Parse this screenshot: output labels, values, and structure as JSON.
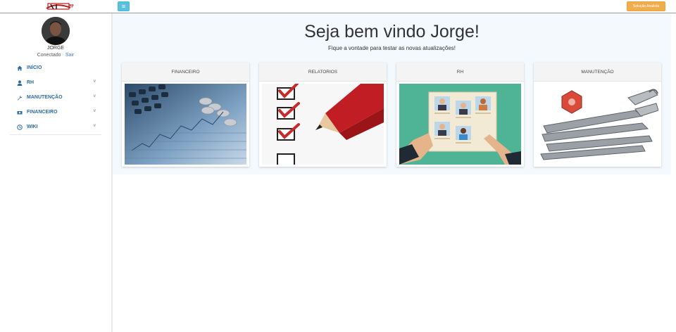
{
  "topbar": {
    "logo_text": "Tempup",
    "menu_toggle_glyph": "≡",
    "right_button_label": "Solução Analista"
  },
  "user": {
    "name": "JORGE",
    "status": "Conectado",
    "logout": "Sair"
  },
  "sidebar": {
    "items": [
      {
        "label": "INÍCIO",
        "icon": "home-icon",
        "has_submenu": false
      },
      {
        "label": "RH",
        "icon": "user-icon",
        "has_submenu": true
      },
      {
        "label": "MANUTENÇÃO",
        "icon": "wrench-icon",
        "has_submenu": true
      },
      {
        "label": "FINANCEIRO",
        "icon": "money-icon",
        "has_submenu": true
      },
      {
        "label": "WIKI",
        "icon": "clock-icon",
        "has_submenu": true
      }
    ],
    "chevron": "v"
  },
  "main": {
    "title": "Seja bem vindo Jorge!",
    "subtitle": "Fique a vontade para testar as novas atualizações!",
    "cards": [
      {
        "label": "FINANCEIRO",
        "image": "finance-photo"
      },
      {
        "label": "RELATORIOS",
        "image": "checklist-photo"
      },
      {
        "label": "RH",
        "image": "hr-illustration"
      },
      {
        "label": "MANUTENÇÃO",
        "image": "tools-photo"
      }
    ]
  },
  "colors": {
    "accent_blue": "#5bc0de",
    "orange": "#f0ad4e",
    "nav_text": "#2d6ba3",
    "jumbo_bg": "#f3f9fd"
  }
}
